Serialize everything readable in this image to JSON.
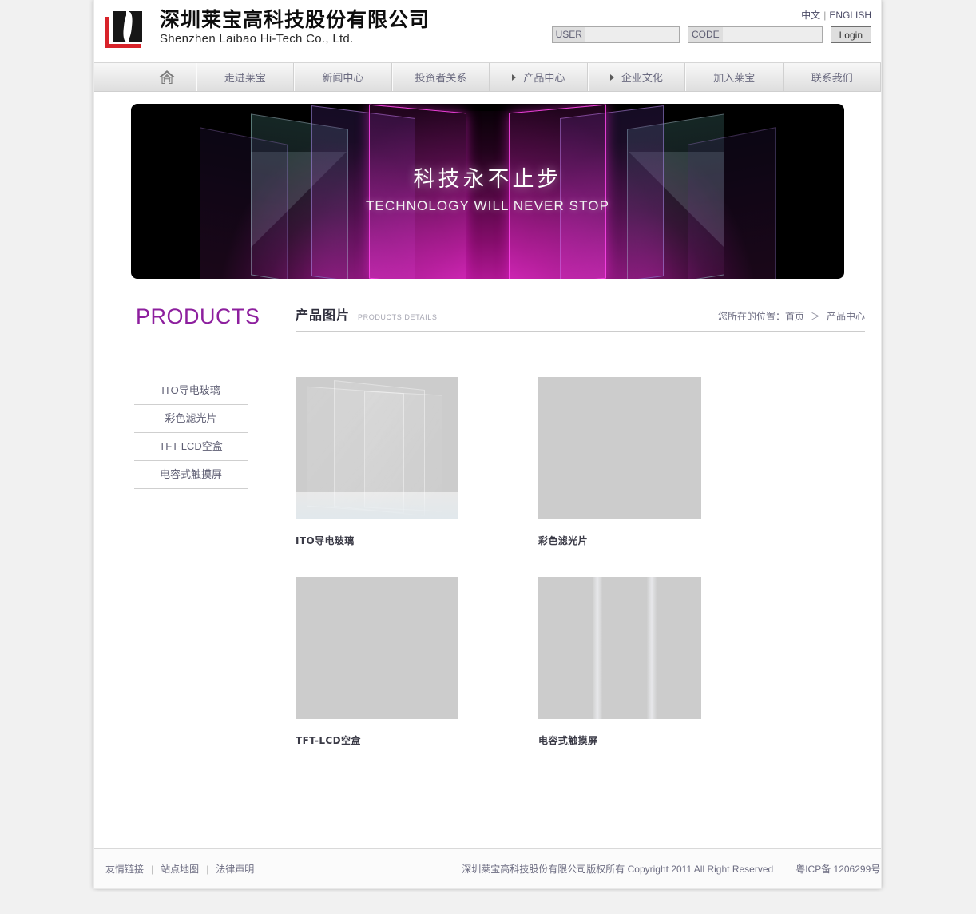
{
  "site": {
    "logo_cn": "深圳莱宝高科技股份有限公司",
    "logo_en": "Shenzhen Laibao Hi-Tech Co., Ltd."
  },
  "lang": {
    "chinese": "中文",
    "separator": "|",
    "english": "ENGLISH"
  },
  "login": {
    "user_label": "USER",
    "user_value": "",
    "code_label": "CODE",
    "code_value": "",
    "button": "Login"
  },
  "nav": {
    "home_icon": "home-icon",
    "items": [
      {
        "label": "走进莱宝",
        "arrow": false
      },
      {
        "label": "新闻中心",
        "arrow": false
      },
      {
        "label": "投资者关系",
        "arrow": false
      },
      {
        "label": "产品中心",
        "arrow": true
      },
      {
        "label": "企业文化",
        "arrow": true
      },
      {
        "label": "加入莱宝",
        "arrow": false
      },
      {
        "label": "联系我们",
        "arrow": false
      }
    ]
  },
  "banner": {
    "headline_cn": "科技永不止步",
    "headline_en": "TECHNOLOGY WILL NEVER STOP"
  },
  "sidebar": {
    "title": "PRODUCTS",
    "items": [
      {
        "label": "ITO导电玻璃"
      },
      {
        "label": "彩色滤光片"
      },
      {
        "label": "TFT-LCD空盒"
      },
      {
        "label": "电容式触摸屏"
      }
    ]
  },
  "main": {
    "title_cn": "产品图片",
    "title_en": "PRODUCTS DETAILS",
    "breadcrumb": {
      "prefix": "您所在的位置：",
      "home": "首页",
      "separator": "＞",
      "current": "产品中心"
    },
    "products": [
      {
        "caption": "ITO导电玻璃",
        "thumb": "ito-glass-thumbnail"
      },
      {
        "caption": "彩色滤光片",
        "thumb": "color-filter-thumbnail"
      },
      {
        "caption": "TFT-LCD空盒",
        "thumb": "tft-lcd-cell-thumbnail"
      },
      {
        "caption": "电容式触摸屏",
        "thumb": "capacitive-touch-panel-thumbnail"
      }
    ]
  },
  "footer": {
    "links": [
      {
        "label": "友情链接"
      },
      {
        "label": "站点地图"
      },
      {
        "label": "法律声明"
      }
    ],
    "link_separator": "|",
    "copyright": "深圳莱宝高科技股份有限公司版权所有 Copyright 2011 All Right Reserved",
    "icp": "粤ICP备 1206299号"
  },
  "colors": {
    "accent_purple": "#8d1f9e",
    "logo_red": "#d8232a",
    "page_bg": "#f1f1f1"
  }
}
